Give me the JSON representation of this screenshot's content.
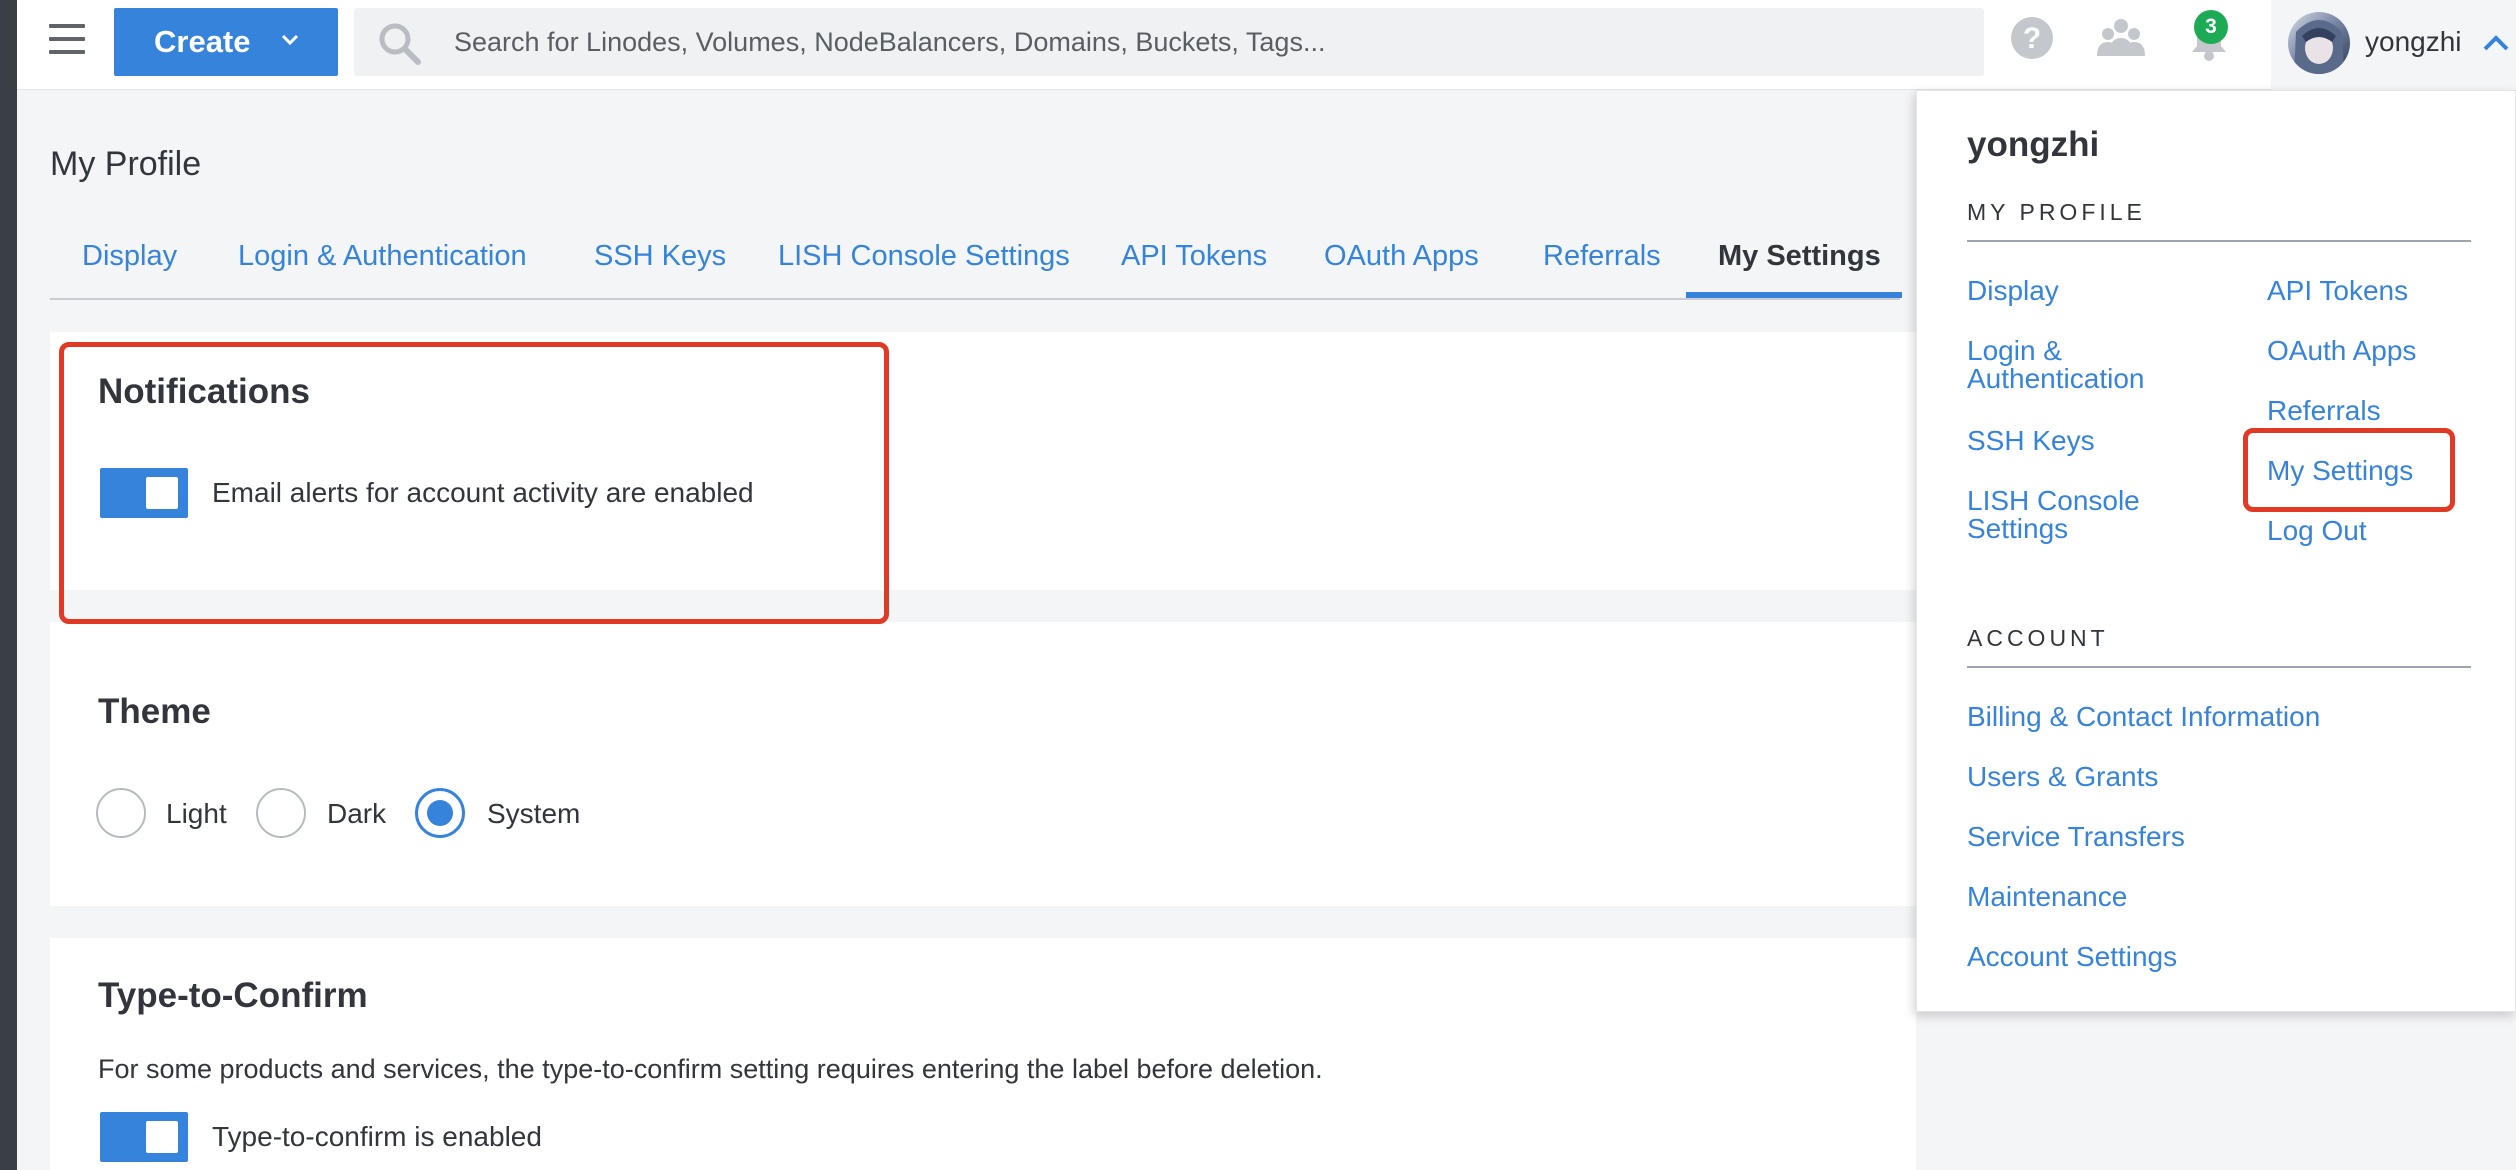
{
  "header": {
    "create_label": "Create",
    "search_placeholder": "Search for Linodes, Volumes, NodeBalancers, Domains, Buckets, Tags...",
    "notification_count": "3",
    "username": "yongzhi"
  },
  "page": {
    "title": "My Profile",
    "tabs": [
      "Display",
      "Login & Authentication",
      "SSH Keys",
      "LISH Console Settings",
      "API Tokens",
      "OAuth Apps",
      "Referrals",
      "My Settings"
    ],
    "active_tab": "My Settings"
  },
  "notifications": {
    "title": "Notifications",
    "toggle_label": "Email alerts for account activity are enabled"
  },
  "theme": {
    "title": "Theme",
    "options": [
      "Light",
      "Dark",
      "System"
    ],
    "selected": "System"
  },
  "type_to_confirm": {
    "title": "Type-to-Confirm",
    "description": "For some products and services, the type-to-confirm setting requires entering the label before deletion.",
    "toggle_label": "Type-to-confirm is enabled"
  },
  "menu": {
    "username": "yongzhi",
    "profile_heading": "MY PROFILE",
    "profile_left": [
      "Display",
      "Login & Authentication",
      "SSH Keys",
      "LISH Console Settings"
    ],
    "profile_right": [
      "API Tokens",
      "OAuth Apps",
      "Referrals",
      "My Settings",
      "Log Out"
    ],
    "account_heading": "ACCOUNT",
    "account_links": [
      "Billing & Contact Information",
      "Users & Grants",
      "Service Transfers",
      "Maintenance",
      "Account Settings"
    ]
  },
  "colors": {
    "accent": "#3683dc",
    "highlight_box": "#e03a24",
    "badge": "#1daa54"
  }
}
